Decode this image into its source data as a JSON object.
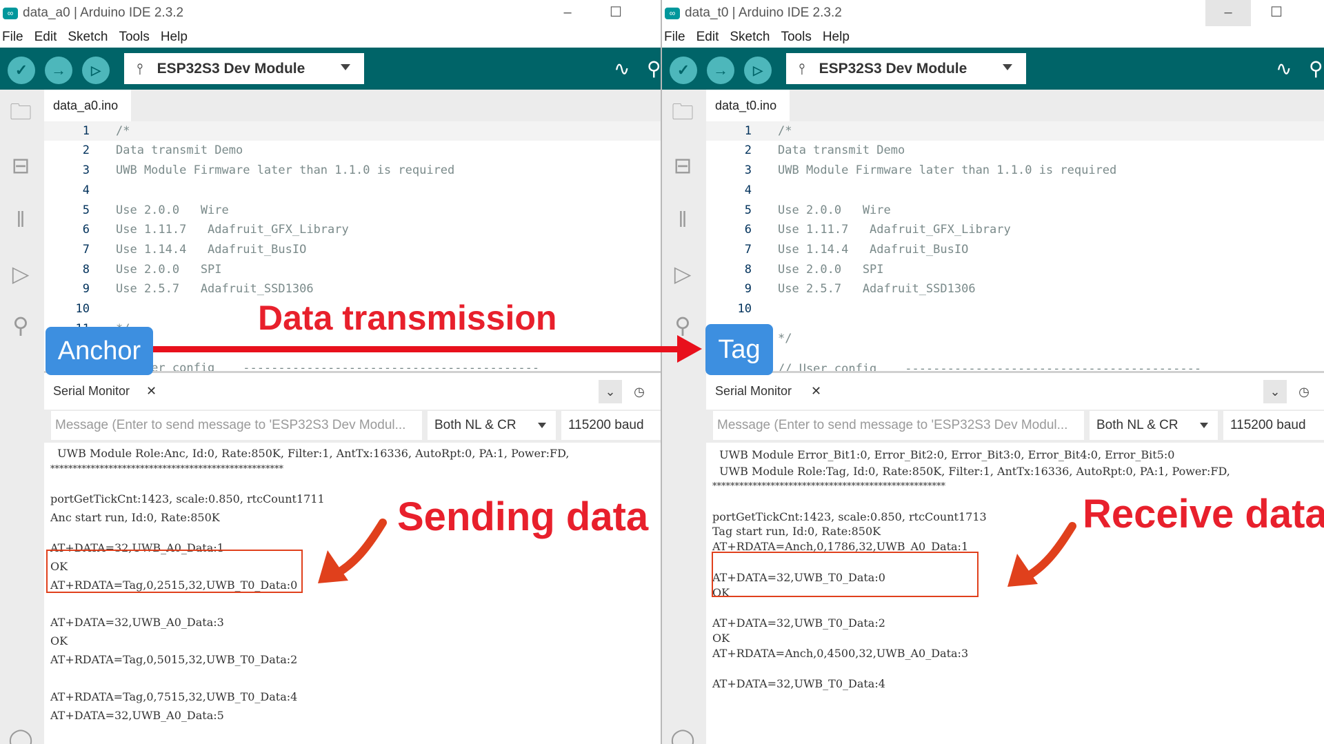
{
  "left_window": {
    "title": "data_a0 | Arduino IDE 2.3.2",
    "menu": [
      "File",
      "Edit",
      "Sketch",
      "Tools",
      "Help"
    ],
    "board": "ESP32S3 Dev Module",
    "file_tab": "data_a0.ino",
    "code_lines": [
      {
        "n": "1",
        "t": "/*"
      },
      {
        "n": "2",
        "t": "Data transmit Demo"
      },
      {
        "n": "3",
        "t": "UWB Module Firmware later than 1.1.0 is required"
      },
      {
        "n": "4",
        "t": ""
      },
      {
        "n": "5",
        "t": "Use 2.0.0   Wire"
      },
      {
        "n": "6",
        "t": "Use 1.11.7   Adafruit_GFX_Library"
      },
      {
        "n": "7",
        "t": "Use 1.14.4   Adafruit_BusIO"
      },
      {
        "n": "8",
        "t": "Use 2.0.0   SPI"
      },
      {
        "n": "9",
        "t": "Use 2.5.7   Adafruit_SSD1306"
      },
      {
        "n": "10",
        "t": ""
      },
      {
        "n": "11",
        "t": "*/"
      },
      {
        "n": "",
        "t": "// User config    ------------------------------------------"
      }
    ],
    "serial_monitor": {
      "title": "Serial Monitor",
      "placeholder": "Message (Enter to send message to 'ESP32S3 Dev Modul...",
      "line_ending": "Both NL & CR",
      "baud": "115200 baud",
      "lines": [
        "  UWB Module Role:Anc, Id:0, Rate:850K, Filter:1, AntTx:16336, AutoRpt:0, PA:1, Power:FD,",
        "****************************************************",
        "",
        "portGetTickCnt:1423, scale:0.850, rtcCount1711",
        "Anc start run, Id:0, Rate:850K",
        "",
        "AT+DATA=32,UWB_A0_Data:1",
        "OK",
        "AT+RDATA=Tag,0,2515,32,UWB_T0_Data:0",
        "",
        "AT+DATA=32,UWB_A0_Data:3",
        "OK",
        "AT+RDATA=Tag,0,5015,32,UWB_T0_Data:2",
        "",
        "AT+RDATA=Tag,0,7515,32,UWB_T0_Data:4",
        "AT+DATA=32,UWB_A0_Data:5"
      ]
    }
  },
  "right_window": {
    "title": "data_t0 | Arduino IDE 2.3.2",
    "menu": [
      "File",
      "Edit",
      "Sketch",
      "Tools",
      "Help"
    ],
    "board": "ESP32S3 Dev Module",
    "file_tab": "data_t0.ino",
    "code_lines": [
      {
        "n": "1",
        "t": "/*"
      },
      {
        "n": "2",
        "t": "Data transmit Demo"
      },
      {
        "n": "3",
        "t": "UWB Module Firmware later than 1.1.0 is required"
      },
      {
        "n": "4",
        "t": ""
      },
      {
        "n": "5",
        "t": "Use 2.0.0   Wire"
      },
      {
        "n": "6",
        "t": "Use 1.11.7   Adafruit_GFX_Library"
      },
      {
        "n": "7",
        "t": "Use 1.14.4   Adafruit_BusIO"
      },
      {
        "n": "8",
        "t": "Use 2.0.0   SPI"
      },
      {
        "n": "9",
        "t": "Use 2.5.7   Adafruit_SSD1306"
      },
      {
        "n": "10",
        "t": ""
      },
      {
        "n": "",
        "t": "*/"
      },
      {
        "n": "",
        "t": "// User config    ------------------------------------------"
      }
    ],
    "serial_monitor": {
      "title": "Serial Monitor",
      "placeholder": "Message (Enter to send message to 'ESP32S3 Dev Modul...",
      "line_ending": "Both NL & CR",
      "baud": "115200 baud",
      "lines": [
        "  UWB Module Error_Bit1:0, Error_Bit2:0, Error_Bit3:0, Error_Bit4:0, Error_Bit5:0",
        "  UWB Module Role:Tag, Id:0, Rate:850K, Filter:1, AntTx:16336, AutoRpt:0, PA:1, Power:FD,",
        "****************************************************",
        "",
        "portGetTickCnt:1423, scale:0.850, rtcCount1713",
        "Tag start run, Id:0, Rate:850K",
        "AT+RDATA=Anch,0,1786,32,UWB_A0_Data:1",
        "",
        "AT+DATA=32,UWB_T0_Data:0",
        "OK",
        "",
        "AT+DATA=32,UWB_T0_Data:2",
        "OK",
        "AT+RDATA=Anch,0,4500,32,UWB_A0_Data:3",
        "",
        "AT+DATA=32,UWB_T0_Data:4"
      ]
    }
  },
  "annotations": {
    "anchor_label": "Anchor",
    "tag_label": "Tag",
    "data_transmission": "Data transmission",
    "sending_data": "Sending data",
    "receive_data": "Receive data"
  },
  "colors": {
    "toolbar": "#006468",
    "button": "#4db7bb",
    "highlight_box": "#e0401c",
    "annotation_text": "#e8202c",
    "badge": "#3d8fe0"
  },
  "icons": {
    "verify": "check-icon",
    "upload": "arrow-right-icon",
    "debug": "debug-icon",
    "plotter": "serial-plotter-icon",
    "monitor": "serial-monitor-icon",
    "usb": "usb-icon",
    "sidebar": [
      "folder-icon",
      "boards-manager-icon",
      "library-icon",
      "debug-icon",
      "search-icon",
      "profile-icon"
    ]
  }
}
